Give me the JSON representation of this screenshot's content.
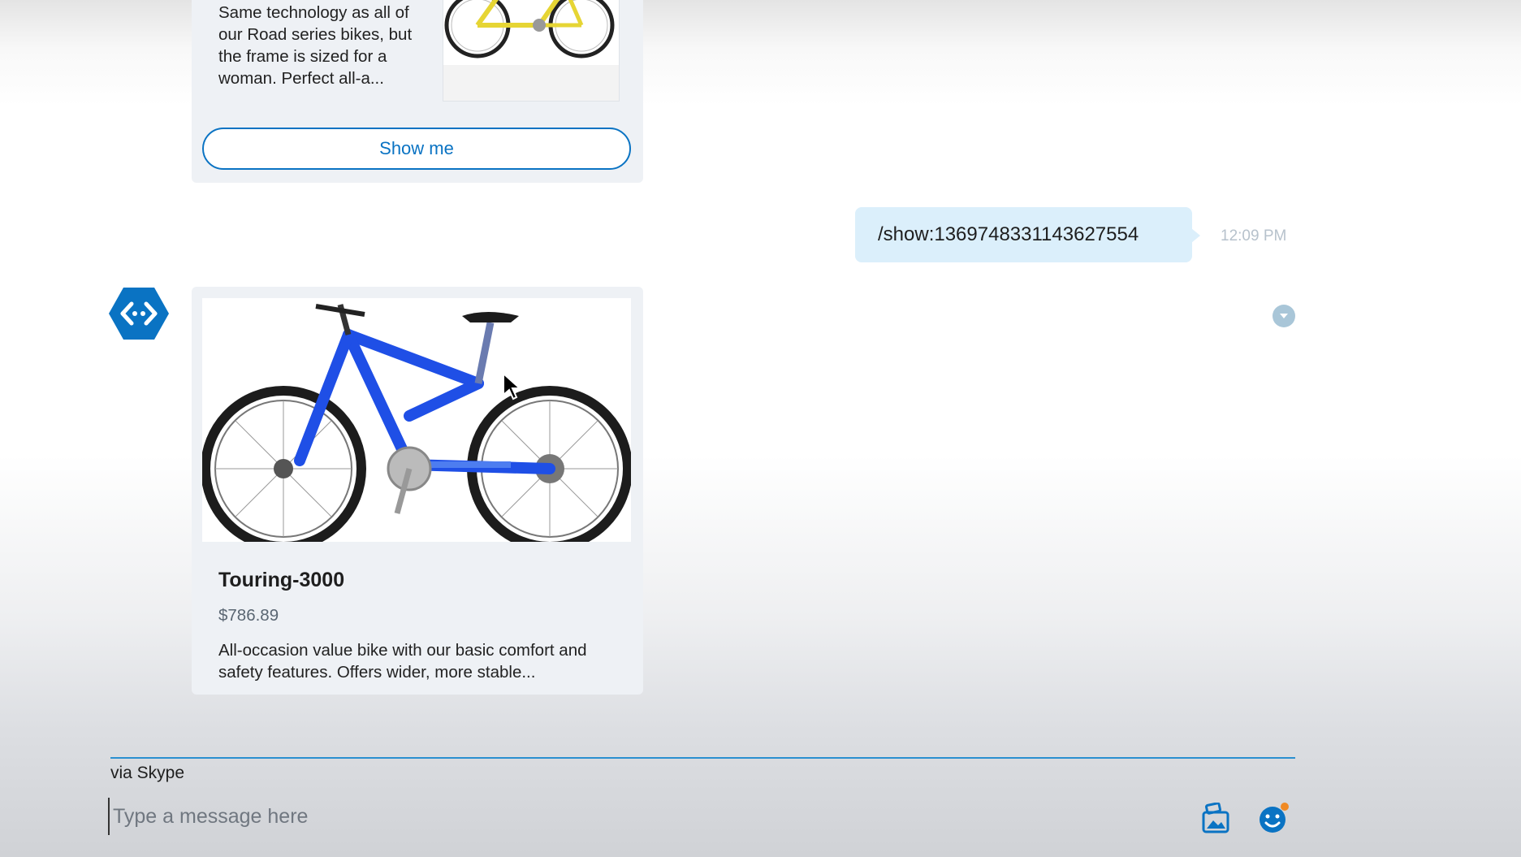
{
  "cards": {
    "previous": {
      "description": "Same technology as all of our Road series bikes, but the frame is sized for a woman.  Perfect all-a...",
      "button_label": "Show me"
    },
    "current": {
      "title": "Touring-3000",
      "price": "$786.89",
      "description": "All-occasion value bike with our basic comfort and safety features. Offers wider, more stable..."
    }
  },
  "user_message": {
    "text": "/show:1369748331143627554",
    "time": "12:09 PM"
  },
  "composer": {
    "channel_label": "via Skype",
    "placeholder": "Type a message here"
  },
  "icons": {
    "bot_avatar": "code-diamond-icon",
    "status": "chevron-down-icon",
    "media": "image-upload-icon",
    "emoji": "emoji-icon"
  },
  "colors": {
    "accent": "#0a73c3",
    "bubble": "#dbeffb",
    "bike_frame": "#1f4fe6",
    "thumb_bike_frame": "#e6d534"
  }
}
